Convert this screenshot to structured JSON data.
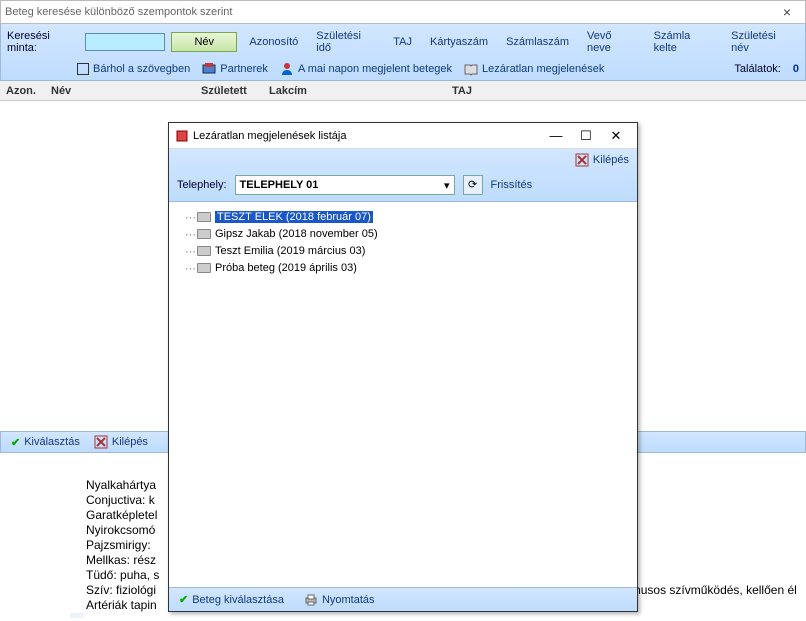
{
  "window": {
    "title": "Beteg keresése különböző szempontok szerint",
    "close": "×"
  },
  "toolbar": {
    "search_label": "Keresési minta:",
    "name_btn": "Név",
    "tabs": [
      "Azonosító",
      "Születési idő",
      "TAJ",
      "Kártyaszám",
      "Számlaszám",
      "Vevő neve",
      "Számla kelte",
      "Születési név"
    ],
    "anywhere": "Bárhol a szövegben",
    "partners": "Partnerek",
    "today": "A mai napon megjelent betegek",
    "open": "Lezáratlan megjelenések",
    "results_label": "Találatok:",
    "results_count": "0"
  },
  "columns": {
    "c1": "Azon.",
    "c2": "Név",
    "c3": "Született",
    "c4": "Lakcím",
    "c5": "TAJ"
  },
  "bottombar": {
    "select": "Kiválasztás",
    "exit": "Kilépés"
  },
  "notes": {
    "l1": "Nyalkahártya",
    "l2": "Conjuctiva: k",
    "l3": "Garatképletel",
    "l4": "Nyirokcsomó",
    "l5": "Pajzsmirigy:",
    "l6": "Mellkas: rész",
    "l7": "Tüdő: puha, s",
    "l8": "Szív: fiziológi",
    "l8b": "musos szívműködés, kellően él",
    "l9": "Artériák tapin"
  },
  "modal": {
    "title": "Lezáratlan megjelenések listája",
    "min": "—",
    "max": "☐",
    "close": "✕",
    "exit": "Kilépés",
    "site_label": "Telephely:",
    "site_value": "TELEPHELY 01",
    "refresh": "Frissítés",
    "items": {
      "i0": "TESZT ELEK (2018 február 07)",
      "i1": "Gipsz Jakab (2018 november 05)",
      "i2": "Teszt Emilia (2019 március 03)",
      "i3": "Próba beteg (2019 április 03)"
    },
    "status": {
      "select": "Beteg kiválasztása",
      "print": "Nyomtatás"
    }
  }
}
